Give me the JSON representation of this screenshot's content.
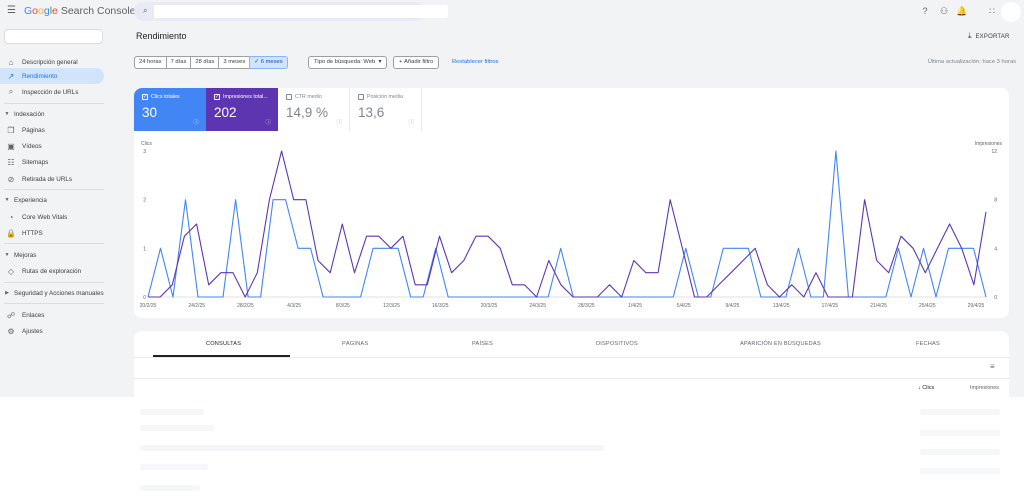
{
  "app": {
    "logo_google": "Google",
    "logo_product": "Search Console"
  },
  "search": {
    "placeholder": ""
  },
  "sidebar": {
    "items": [
      {
        "label": "Descripción general",
        "icon": "home-icon"
      },
      {
        "label": "Rendimiento",
        "icon": "trending-up-icon",
        "active": true
      },
      {
        "label": "Inspección de URLs",
        "icon": "search-icon"
      },
      {
        "section": "Indexación"
      },
      {
        "label": "Páginas",
        "icon": "pages-icon"
      },
      {
        "label": "Vídeos",
        "icon": "video-icon"
      },
      {
        "label": "Sitemaps",
        "icon": "sitemap-icon"
      },
      {
        "label": "Retirada de URLs",
        "icon": "eye-off-icon"
      },
      {
        "section": "Experiencia"
      },
      {
        "label": "Core Web Vitals",
        "icon": "gauge-icon"
      },
      {
        "label": "HTTPS",
        "icon": "lock-icon"
      },
      {
        "section": "Mejoras"
      },
      {
        "label": "Rutas de exploración",
        "icon": "breadcrumb-icon"
      },
      {
        "section": "Seguridad y Acciones manuales"
      },
      {
        "label": "Enlaces",
        "icon": "link-icon"
      },
      {
        "label": "Ajustes",
        "icon": "gear-icon"
      }
    ]
  },
  "header": {
    "title": "Rendimiento",
    "export_label": "EXPORTAR",
    "last_update": "Última actualización: hace 3 horas"
  },
  "filters": {
    "ranges": [
      "24 horas",
      "7 días",
      "28 días",
      "3 meses",
      "✓  6 meses"
    ],
    "selected_range": "6 meses",
    "search_type": "Tipo de búsqueda: Web",
    "add_filter": "Añadir filtro",
    "reset": "Restablecer filtros"
  },
  "metrics": {
    "clicks": {
      "label": "Clics totales",
      "value": "30",
      "checked": true,
      "color": "#4285f4"
    },
    "impressions": {
      "label": "Impresiones total...",
      "value": "202",
      "checked": true,
      "color": "#5e35b1"
    },
    "ctr": {
      "label": "CTR medio",
      "value": "14,9 %",
      "checked": false
    },
    "position": {
      "label": "Posición media",
      "value": "13,6",
      "checked": false
    }
  },
  "chart_data": {
    "type": "line",
    "left_axis_label": "Clics",
    "right_axis_label": "Impresiones",
    "left_ticks": [
      "3",
      "2",
      "1",
      "0"
    ],
    "right_ticks": [
      "12",
      "8",
      "4",
      "0"
    ],
    "left_ylim": [
      0,
      3
    ],
    "right_ylim": [
      0,
      12
    ],
    "x_ticks": [
      "20/2/25",
      "24/2/25",
      "28/2/25",
      "4/3/25",
      "8/3/25",
      "12/3/25",
      "16/3/25",
      "20/3/25",
      "24/3/25",
      "28/3/25",
      "1/4/25",
      "5/4/25",
      "9/4/25",
      "13/4/25",
      "17/4/25",
      "21/4/25",
      "25/4/25",
      "29/4/25"
    ],
    "series": [
      {
        "name": "Clics totales",
        "color": "#4285f4",
        "axis": "left",
        "values": [
          0,
          1,
          0,
          2,
          0,
          0,
          0,
          2,
          0,
          0,
          2,
          2,
          1,
          1,
          0,
          0,
          0,
          0,
          1,
          1,
          1,
          0,
          0,
          1,
          0,
          0,
          0,
          0,
          0,
          0,
          0,
          0,
          0,
          1,
          0,
          0,
          0,
          0,
          0,
          0,
          0,
          0,
          0,
          1,
          0,
          0,
          1,
          1,
          1,
          0,
          0,
          0,
          1,
          0,
          0,
          3,
          0,
          0,
          0,
          0,
          1,
          0,
          1,
          0,
          1,
          1,
          1,
          0
        ]
      },
      {
        "name": "Impresiones totales",
        "color": "#5e35b1",
        "axis": "left",
        "values": [
          0,
          0,
          0.25,
          1.25,
          1.5,
          0.25,
          0.5,
          0.5,
          0,
          0.5,
          2,
          3,
          2,
          2,
          0.75,
          0.5,
          1.5,
          0.5,
          1.25,
          1.25,
          1,
          1.25,
          0.25,
          0.25,
          1.25,
          0.5,
          0.75,
          1.25,
          1.25,
          1,
          0.25,
          0.25,
          0,
          0.75,
          0.25,
          0,
          0,
          0,
          0.25,
          0,
          0.75,
          0.5,
          0.5,
          2,
          1,
          0,
          0,
          0.25,
          0.5,
          0.75,
          1,
          0.25,
          0,
          0.25,
          0,
          0.5,
          0,
          0,
          0,
          2,
          0.75,
          0.5,
          1.25,
          1,
          0.5,
          1,
          1.5,
          1,
          0.25,
          1.75
        ]
      }
    ]
  },
  "table": {
    "tabs": [
      "CONSULTAS",
      "PÁGINAS",
      "PAÍSES",
      "DISPOSITIVOS",
      "APARICIÓN EN BÚSQUEDAS",
      "FECHAS"
    ],
    "active_tab": "CONSULTAS",
    "columns": [
      "Clics",
      "Impresiones"
    ],
    "sort_arrow": "↓"
  }
}
